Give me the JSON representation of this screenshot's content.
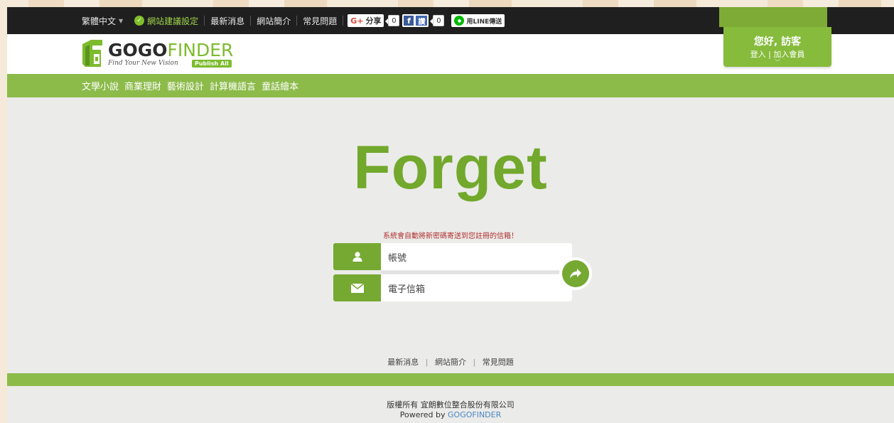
{
  "topbar": {
    "language": "繁體中文",
    "recommend": "網站建議設定",
    "links": [
      "最新消息",
      "網站簡介",
      "常見問題"
    ],
    "share": {
      "gplus_label": "分享",
      "gplus_count": "0",
      "fb_label": "讚",
      "fb_count": "0",
      "line_label": "用LINE傳送"
    }
  },
  "header": {
    "logo_go": "GOGO",
    "logo_finder": "FINDER",
    "tagline": "Find Your New Vision",
    "publish": "Publish All",
    "greeting": "您好, 訪客",
    "login": "登入",
    "register": "加入會員"
  },
  "nav": {
    "items": [
      "文學小說",
      "商業理財",
      "藝術設計",
      "計算機語言",
      "童話繪本"
    ]
  },
  "main": {
    "title": "Forget",
    "notice": "系統會自動將新密碼寄送到您註冊的信箱！",
    "account_placeholder": "帳號",
    "email_placeholder": "電子信箱"
  },
  "footer": {
    "links": [
      "最新消息",
      "網站簡介",
      "常見問題"
    ],
    "copyright": "版權所有 宜朗數位整合股份有限公司",
    "powered_prefix": "Powered by",
    "powered_brand": "GOGOFINDER"
  },
  "colors": {
    "brand_green": "#7dbb2d",
    "nav_green": "#8cbb4a",
    "dark_bar": "#1f1f1f",
    "notice_red": "#b03030"
  }
}
